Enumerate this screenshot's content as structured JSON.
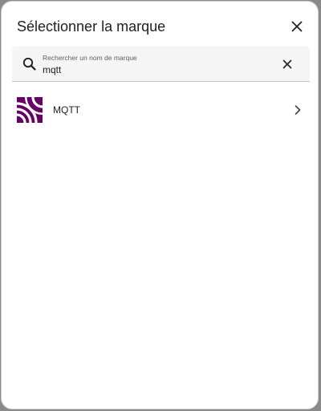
{
  "dialog": {
    "title": "Sélectionner la marque"
  },
  "search": {
    "label": "Rechercher un nom de marque",
    "value": "mqtt"
  },
  "brands": [
    {
      "name": "MQTT",
      "logo_color": "#660066"
    }
  ],
  "colors": {
    "text_primary": "#212121",
    "text_secondary": "#5f5f5f",
    "field_background": "#f5f5f5",
    "brand_purple": "#660066"
  }
}
